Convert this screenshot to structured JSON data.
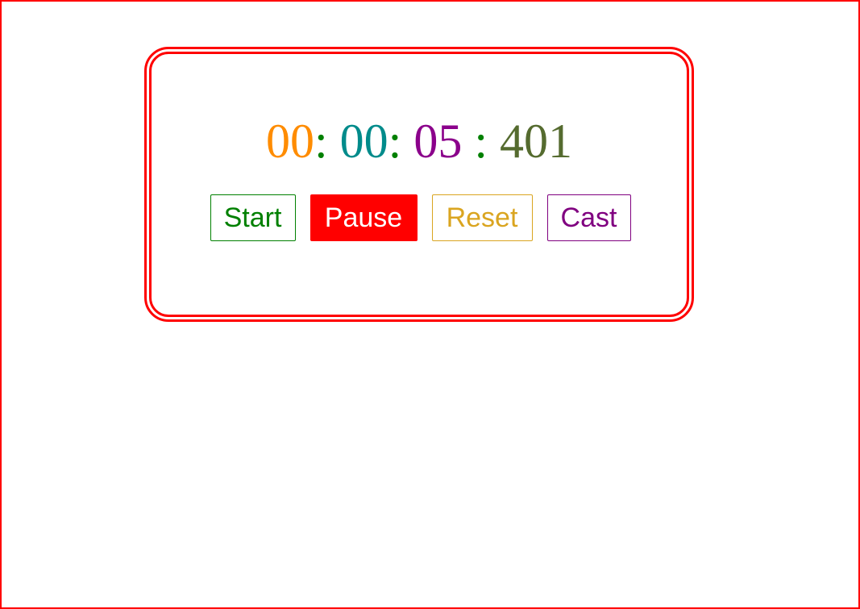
{
  "time": {
    "hours": "00",
    "sep1": ": ",
    "minutes": "00",
    "sep2": ": ",
    "seconds": "05",
    "sep3": " : ",
    "milliseconds": "401"
  },
  "buttons": {
    "start_label": "Start",
    "pause_label": "Pause",
    "reset_label": "Reset",
    "cast_label": "Cast"
  },
  "colors": {
    "frame": "#ff0000",
    "hours": "#ff8c00",
    "separator": "#008000",
    "minutes": "#008b8b",
    "seconds": "#8b008b",
    "milliseconds": "#556b2f",
    "start": "#008000",
    "pause_bg": "#ff0000",
    "pause_text": "#ffffff",
    "reset": "#daa520",
    "cast": "#800080"
  }
}
